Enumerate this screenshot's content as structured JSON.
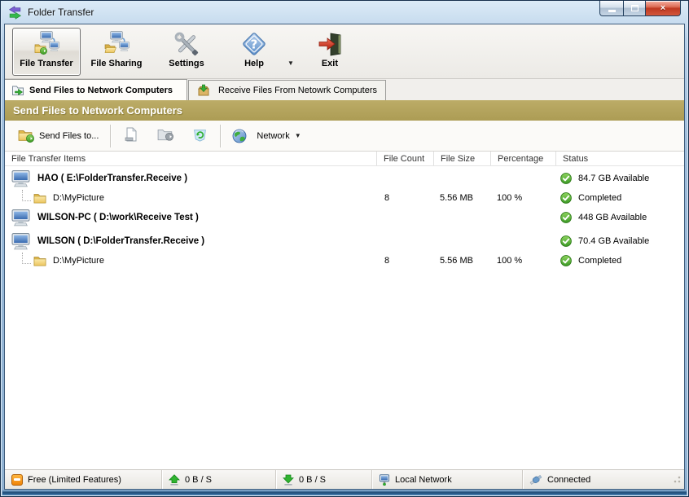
{
  "window": {
    "title": "Folder Transfer"
  },
  "toolbar": {
    "buttons": [
      {
        "label": "File Transfer",
        "active": true
      },
      {
        "label": "File Sharing",
        "active": false
      },
      {
        "label": "Settings",
        "active": false
      },
      {
        "label": "Help",
        "active": false
      },
      {
        "label": "Exit",
        "active": false
      }
    ]
  },
  "tabs": [
    {
      "label": "Send Files to Network Computers",
      "active": true
    },
    {
      "label": "Receive Files From Netowrk Computers",
      "active": false
    }
  ],
  "section_header": "Send Files to Network Computers",
  "actionbar": {
    "send_files_label": "Send Files to...",
    "network_label": "Network"
  },
  "table": {
    "columns": [
      "File Transfer Items",
      "File Count",
      "File Size",
      "Percentage",
      "Status"
    ],
    "rows": [
      {
        "type": "computer",
        "name": "HAO ( E:\\FolderTransfer.Receive )",
        "file_count": "",
        "file_size": "",
        "percentage": "",
        "status": "84.7 GB Available"
      },
      {
        "type": "folder",
        "name": "D:\\MyPicture",
        "file_count": "8",
        "file_size": "5.56 MB",
        "percentage": "100 %",
        "status": "Completed"
      },
      {
        "type": "computer",
        "name": "WILSON-PC ( D:\\work\\Receive Test )",
        "file_count": "",
        "file_size": "",
        "percentage": "",
        "status": "448 GB Available"
      },
      {
        "type": "computer",
        "name": "WILSON ( D:\\FolderTransfer.Receive )",
        "file_count": "",
        "file_size": "",
        "percentage": "",
        "status": "70.4 GB Available"
      },
      {
        "type": "folder",
        "name": "D:\\MyPicture",
        "file_count": "8",
        "file_size": "5.56 MB",
        "percentage": "100 %",
        "status": "Completed"
      }
    ]
  },
  "statusbar": {
    "license": "Free (Limited Features)",
    "upload_speed": "0 B / S",
    "download_speed": "0 B / S",
    "network": "Local Network",
    "connection": "Connected"
  },
  "icons": {
    "app": "transfer-arrows",
    "status_ok": "green-check-circle",
    "license": "orange-badge",
    "upload": "green-up-arrow",
    "download": "green-down-arrow",
    "network": "monitor-lan",
    "connection": "plug"
  },
  "colors": {
    "section_header_bg": "#b3a35f",
    "status_green": "#3aa32c",
    "titlebar_blue": "#9cbbd9",
    "exit_red": "#d5341f",
    "license_orange": "#f08a12"
  }
}
